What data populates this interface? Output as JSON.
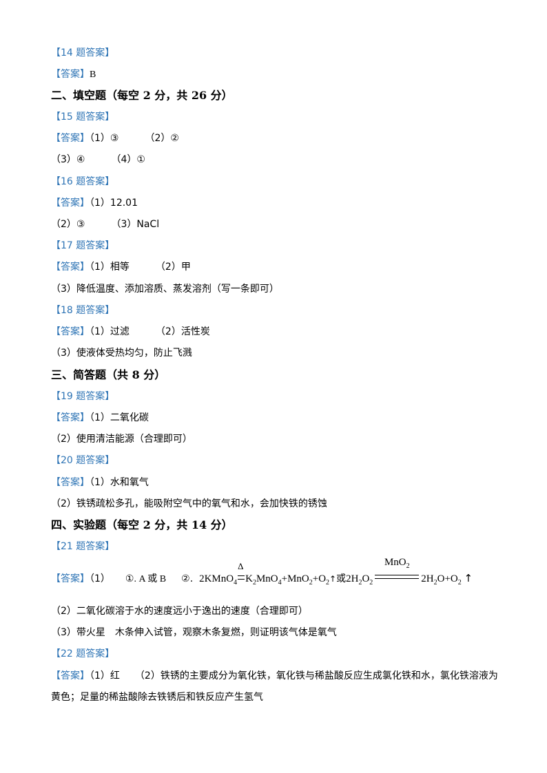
{
  "lines": [
    {
      "tag": "【14 题答案】"
    },
    {
      "tag": "【答案】",
      "text": "B"
    },
    {
      "heading": "二、填空题（每空 2 分，共 26 分）"
    },
    {
      "tag": "【15 题答案】"
    },
    {
      "tag": "【答案】",
      "parts": [
        "（1）③",
        "（2）②"
      ]
    },
    {
      "parts": [
        "（3）④",
        "（4）①"
      ]
    },
    {
      "tag": "【16 题答案】"
    },
    {
      "tag": "【答案】",
      "parts": [
        "（1）12.01"
      ]
    },
    {
      "parts": [
        "（2）③",
        "（3）NaCl"
      ]
    },
    {
      "tag": "【17 题答案】"
    },
    {
      "tag": "【答案】",
      "parts": [
        "（1）相等",
        "（2）甲"
      ]
    },
    {
      "text": "（3）降低温度、添加溶质、蒸发溶剂（写一条即可）"
    },
    {
      "tag": "【18 题答案】"
    },
    {
      "tag": "【答案】",
      "parts": [
        "（1）过滤",
        "（2）活性炭"
      ]
    },
    {
      "text": "（3）使液体受热均匀，防止飞溅"
    },
    {
      "heading": "三、简答题（共 8 分）"
    },
    {
      "tag": "【19 题答案】"
    },
    {
      "tag": "【答案】",
      "text": "（1）二氧化碳"
    },
    {
      "text": "（2）使用清洁能源（合理即可）"
    },
    {
      "tag": "【20 题答案】"
    },
    {
      "tag": "【答案】",
      "text": "（1）水和氧气"
    },
    {
      "text": "（2）铁锈疏松多孔，能吸附空气中的氧气和水，会加快铁的锈蚀"
    },
    {
      "heading": "四、实验题（每空 2 分，共 14 分）"
    },
    {
      "tag": "【21 题答案】"
    },
    {
      "tag": "【答案】"
    },
    {
      "text": "（2）二氧化碳溶于水的速度远小于逸出的速度（合理即可）"
    },
    {
      "text": "（3）带火星　木条伸入试管，观察木条复燃，则证明该气体是氧气"
    },
    {
      "tag": "【22 题答案】"
    },
    {
      "tag": "【答案】",
      "parts": [
        "（1）红",
        "（2）铁锈的主要成分为氧化铁，氧化铁与稀盐酸反应生成氯化铁和水，氯化铁溶液为"
      ]
    },
    {
      "text": "黄色；足量的稀盐酸除去铁锈后和铁反应产生氢气"
    }
  ],
  "q21": {
    "part1_label": "（1）",
    "opt1": "①. A 或 B",
    "opt2_label": "②.",
    "eq1": {
      "lhs": "2KMnO",
      "lhs_sub": "4",
      "condition": "Δ",
      "p1": "K",
      "p1_sub1": "2",
      "p1_mid": "MnO",
      "p1_sub2": "4",
      "p2": "+MnO",
      "p2_sub": "2",
      "p3": "+O",
      "p3_sub": "2",
      "gas_arrow": "↑"
    },
    "or_text": "或",
    "eq2": {
      "lhs": "2H",
      "lhs_sub1": "2",
      "lhs_mid": "O",
      "lhs_sub2": "2",
      "catalyst": "MnO",
      "catalyst_sub": "2",
      "p1": "2H",
      "p1_sub": "2",
      "p1_mid": "O+O",
      "p2_sub": "2",
      "gas_arrow": "↑"
    }
  }
}
